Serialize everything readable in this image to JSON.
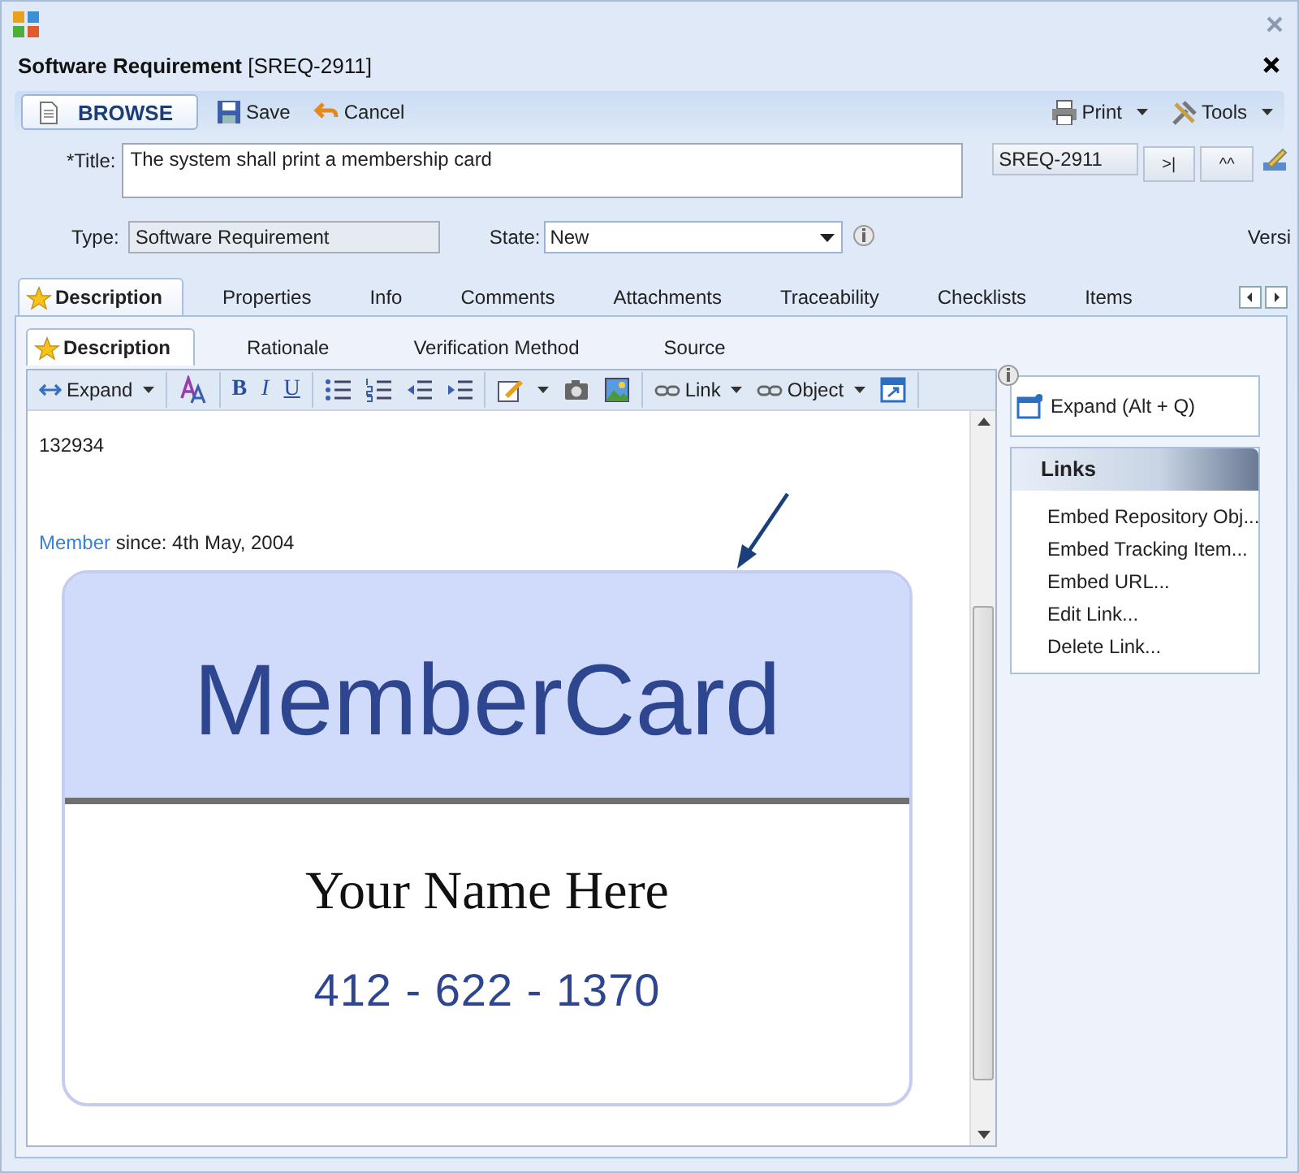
{
  "window": {
    "title": "**Software Requirement** [SREQ-2911]"
  },
  "toolbar": {
    "mode": "BROWSE",
    "buttons": [
      {
        "label": "Save",
        "kind": "save"
      },
      {
        "label": "Cancel",
        "kind": "cancel"
      }
    ],
    "right_buttons": [
      {
        "label": "Print",
        "kind": "print"
      },
      {
        "label": "Tools",
        "kind": "tools"
      }
    ]
  },
  "title_field": {
    "label": "*Title:",
    "value": "The system shall print a membership card"
  },
  "id_field": {
    "value": "SREQ-2911"
  },
  "nav_buttons": [
    ">|",
    "^^"
  ],
  "type_field": {
    "label": "Type:",
    "value": "Software Requirement"
  },
  "state_field": {
    "label": "State:",
    "value": "New"
  },
  "version_label": "Versi",
  "tabs": [
    {
      "label": "Description",
      "selected": true
    },
    {
      "label": "Properties",
      "selected": false
    },
    {
      "label": "Info",
      "selected": false
    },
    {
      "label": "Comments",
      "selected": false
    },
    {
      "label": "Attachments",
      "selected": false
    },
    {
      "label": "Traceability",
      "selected": false
    },
    {
      "label": "Checklists",
      "selected": false
    },
    {
      "label": "Items",
      "selected": false
    }
  ],
  "subtabs": [
    {
      "label": "Description",
      "selected": true
    },
    {
      "label": "Rationale",
      "selected": false
    },
    {
      "label": "Verification Method",
      "selected": false
    },
    {
      "label": "Source",
      "selected": false
    }
  ],
  "editor_toolbar": {
    "expand": "Expand",
    "bold": "B",
    "italic": "I",
    "underline": "U",
    "link": "Link",
    "object": "Object"
  },
  "editor": {
    "lines": [
      {
        "kind": "text",
        "text": "132934"
      },
      {
        "kind": "member",
        "link": "Member",
        "text": " since: 4th May, 2004"
      }
    ],
    "card": {
      "brand": "MemberCard",
      "name": "Your Name Here",
      "phone": "412 - 622 - 1370"
    }
  },
  "side_panel": {
    "expand": "Expand (Alt + Q)",
    "links_title": "Links",
    "links": [
      "Embed Repository Obj...",
      "Embed Tracking Item...",
      "Embed URL...",
      "Edit Link...",
      "Delete Link..."
    ]
  }
}
